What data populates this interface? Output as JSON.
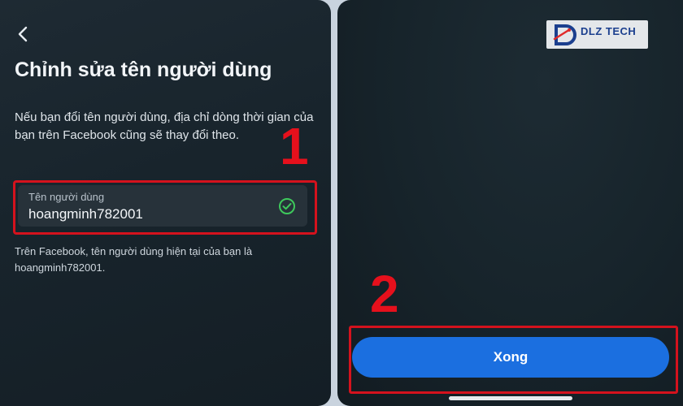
{
  "left_screen": {
    "title": "Chỉnh sửa tên người dùng",
    "description": "Nếu bạn đổi tên người dùng, địa chỉ dòng thời gian của bạn trên Facebook cũng sẽ thay đổi theo.",
    "step_marker": "1",
    "username_field": {
      "label": "Tên người dùng",
      "value": "hoangminh782001",
      "status_icon": "check-circle-icon"
    },
    "current_username_note": "Trên Facebook, tên người dùng hiện tại của bạn là hoangminh782001.",
    "back_icon": "chevron-left-icon"
  },
  "right_screen": {
    "step_marker": "2",
    "done_button_label": "Xong",
    "logo": {
      "text": "DLZ TECH"
    }
  },
  "colors": {
    "highlight": "#d4121d",
    "step_marker": "#e6101c",
    "primary_button": "#1b6fe0",
    "success_check": "#3ec95c"
  }
}
